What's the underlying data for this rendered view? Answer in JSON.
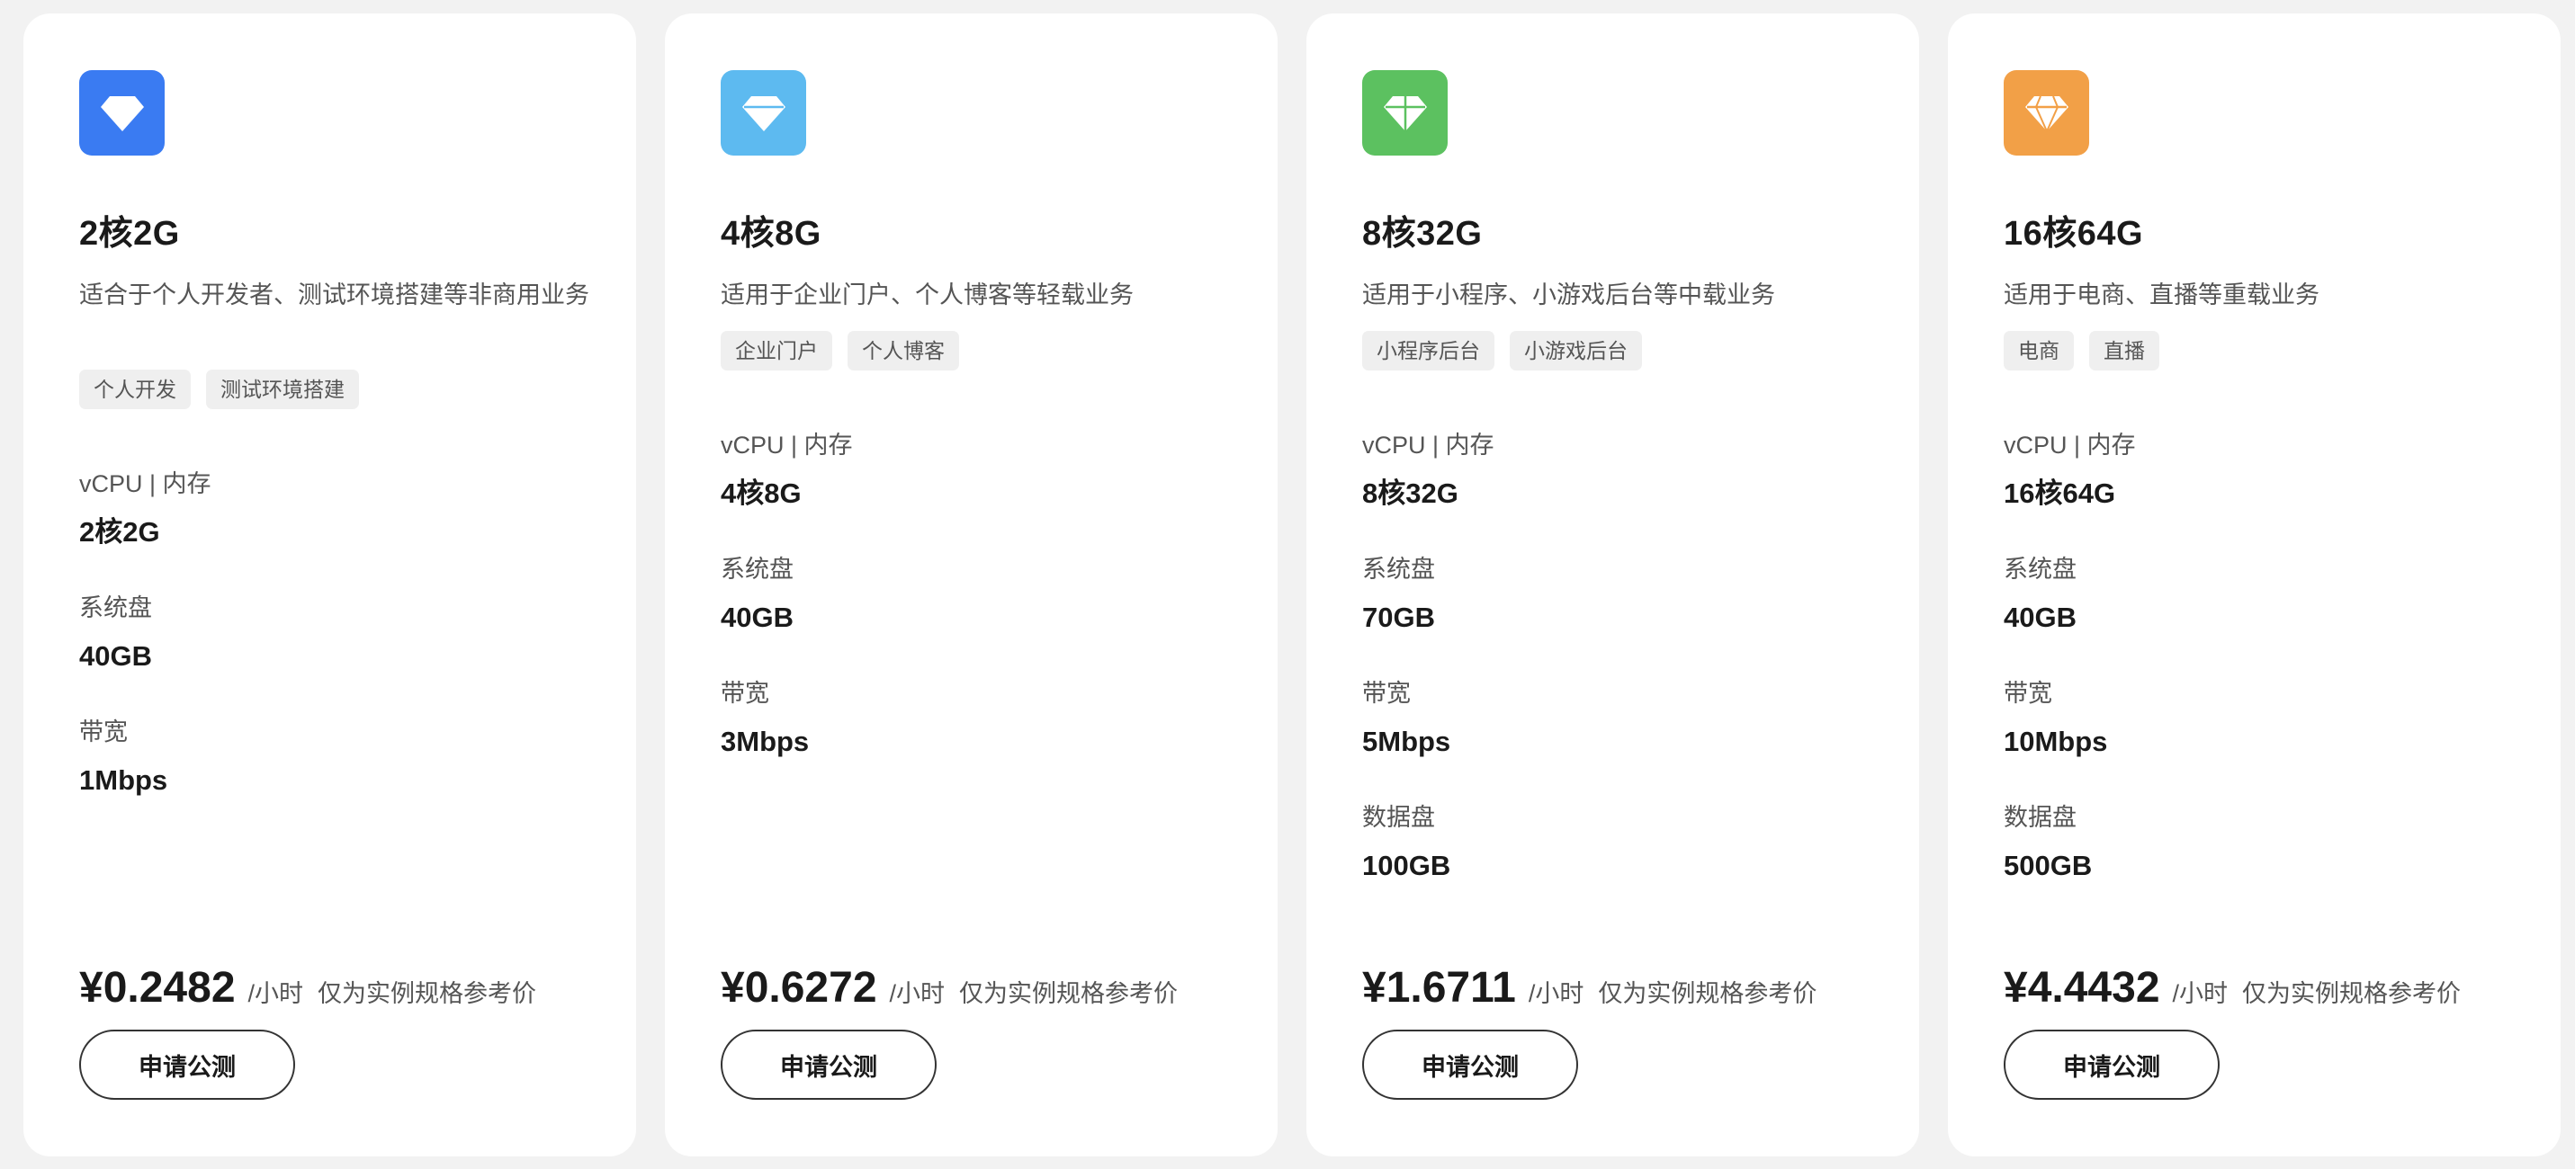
{
  "plans": [
    {
      "name": "2核2G",
      "description": "适合于个人开发者、测试环境搭建等非商用业务",
      "tags": [
        "个人开发",
        "测试环境搭建"
      ],
      "icon": {
        "name": "diamond-icon",
        "color": "#3a7bf2",
        "style": "filled"
      },
      "specs": [
        {
          "label": "vCPU | 内存",
          "value": "2核2G"
        },
        {
          "label": "系统盘",
          "value": "40GB"
        },
        {
          "label": "带宽",
          "value": "1Mbps"
        }
      ],
      "price": "¥0.2482",
      "unit": "/小时",
      "note": "仅为实例规格参考价",
      "button_label": "申请公测"
    },
    {
      "name": "4核8G",
      "description": "适用于企业门户、个人博客等轻载业务",
      "tags": [
        "企业门户",
        "个人博客"
      ],
      "icon": {
        "name": "diamond-icon",
        "color": "#5dbaf0",
        "style": "faceted"
      },
      "specs": [
        {
          "label": "vCPU | 内存",
          "value": "4核8G"
        },
        {
          "label": "系统盘",
          "value": "40GB"
        },
        {
          "label": "带宽",
          "value": "3Mbps"
        }
      ],
      "price": "¥0.6272",
      "unit": "/小时",
      "note": "仅为实例规格参考价",
      "button_label": "申请公测"
    },
    {
      "name": "8核32G",
      "description": "适用于小程序、小游戏后台等中载业务",
      "tags": [
        "小程序后台",
        "小游戏后台"
      ],
      "icon": {
        "name": "diamond-icon",
        "color": "#5cc160",
        "style": "faceted"
      },
      "specs": [
        {
          "label": "vCPU | 内存",
          "value": "8核32G"
        },
        {
          "label": "系统盘",
          "value": "70GB"
        },
        {
          "label": "带宽",
          "value": "5Mbps"
        },
        {
          "label": "数据盘",
          "value": "100GB"
        }
      ],
      "price": "¥1.6711",
      "unit": "/小时",
      "note": "仅为实例规格参考价",
      "button_label": "申请公测"
    },
    {
      "name": "16核64G",
      "description": "适用于电商、直播等重载业务",
      "tags": [
        "电商",
        "直播"
      ],
      "icon": {
        "name": "diamond-icon",
        "color": "#f2a047",
        "style": "faceted"
      },
      "specs": [
        {
          "label": "vCPU | 内存",
          "value": "16核64G"
        },
        {
          "label": "系统盘",
          "value": "40GB"
        },
        {
          "label": "带宽",
          "value": "10Mbps"
        },
        {
          "label": "数据盘",
          "value": "500GB"
        }
      ],
      "price": "¥4.4432",
      "unit": "/小时",
      "note": "仅为实例规格参考价",
      "button_label": "申请公测"
    }
  ]
}
